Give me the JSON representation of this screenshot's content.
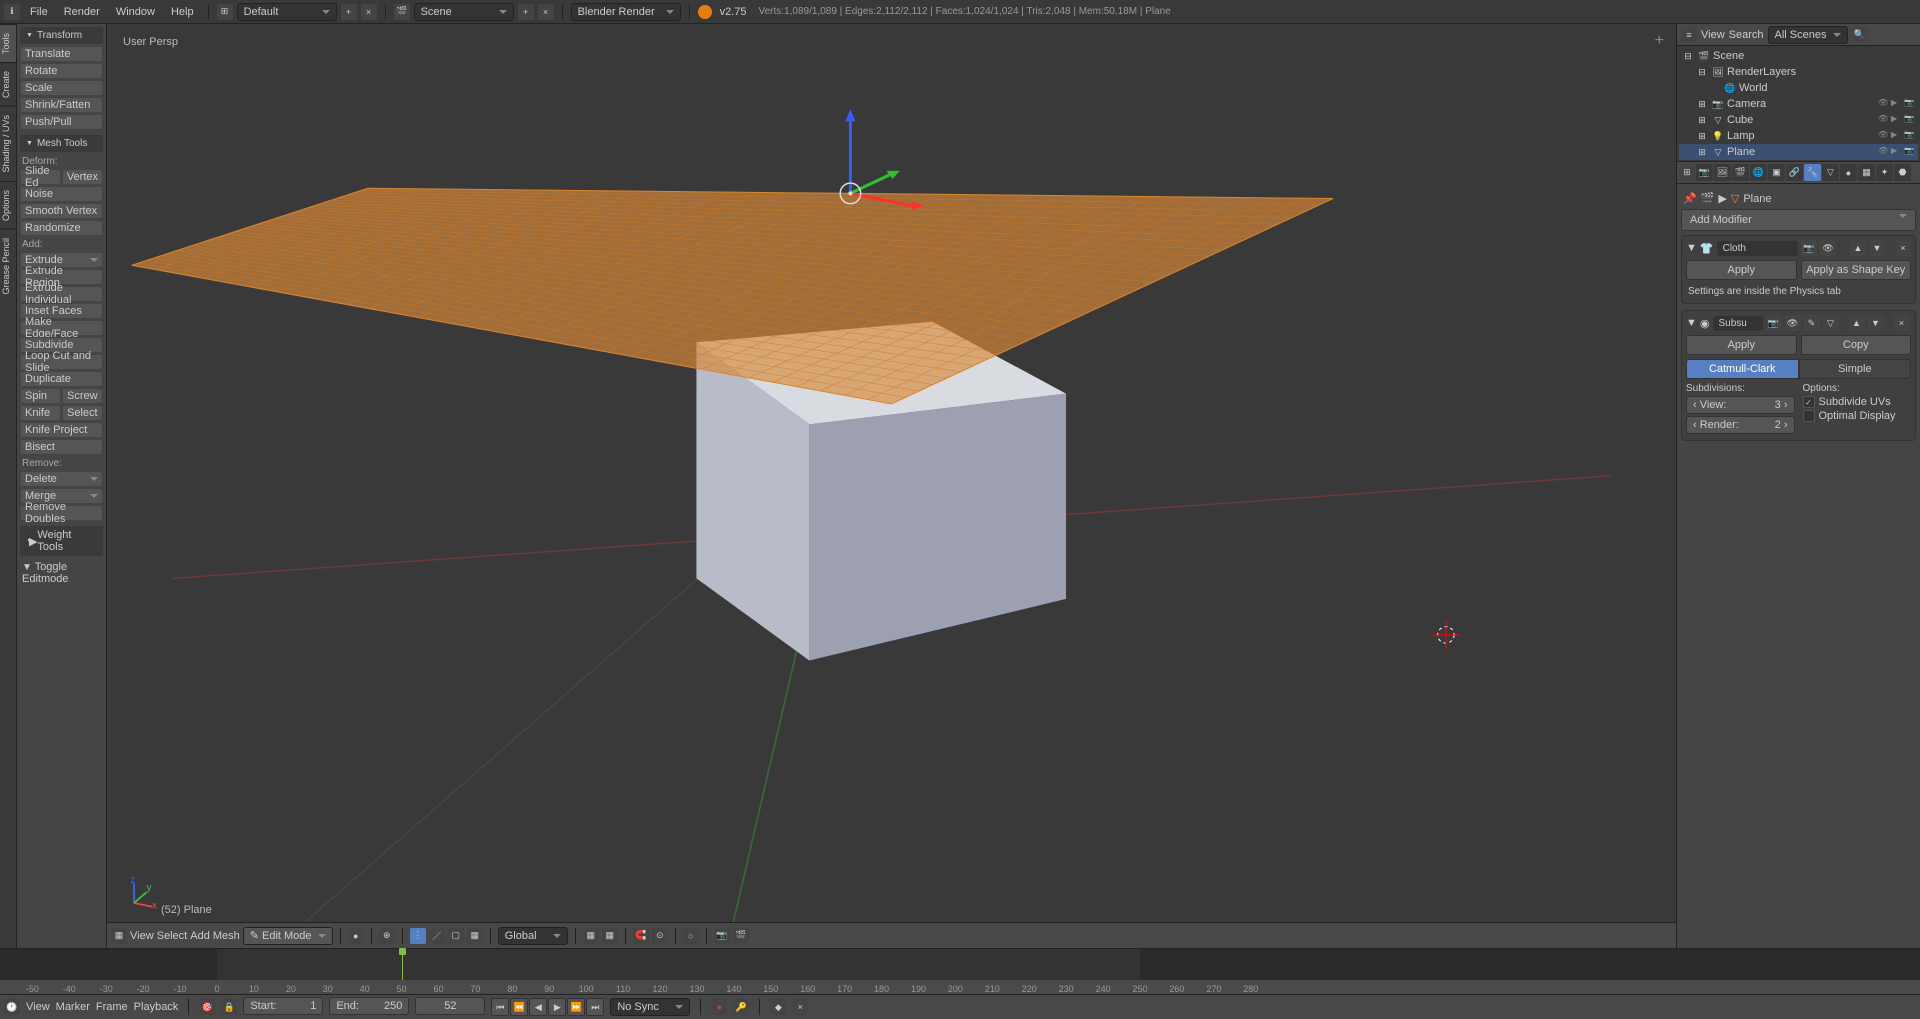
{
  "header": {
    "menus": [
      "File",
      "Render",
      "Window",
      "Help"
    ],
    "layout": "Default",
    "scene": "Scene",
    "engine": "Blender Render",
    "version": "v2.75",
    "stats": "Verts:1,089/1,089 | Edges:2,112/2,112 | Faces:1,024/1,024 | Tris:2,048 | Mem:50.18M | Plane"
  },
  "toolshelf": {
    "tabs": [
      "Tools",
      "Create",
      "Shading / UVs",
      "Options",
      "Grease Pencil"
    ],
    "transform": {
      "title": "Transform",
      "items": [
        "Translate",
        "Rotate",
        "Scale",
        "Shrink/Fatten",
        "Push/Pull"
      ]
    },
    "meshtools": {
      "title": "Mesh Tools",
      "deform_label": "Deform:",
      "deform": [
        "Slide Ed",
        "Vertex",
        "Noise",
        "Smooth Vertex",
        "Randomize"
      ],
      "add_label": "Add:",
      "add": [
        "Extrude",
        "Extrude Region",
        "Extrude Individual",
        "Inset Faces",
        "Make Edge/Face",
        "Subdivide",
        "Loop Cut and Slide",
        "Duplicate",
        "Spin",
        "Screw",
        "Knife",
        "Select",
        "Knife Project",
        "Bisect"
      ],
      "remove_label": "Remove:",
      "remove": [
        "Delete",
        "Merge",
        "Remove Doubles"
      ]
    },
    "weighttools": "Weight Tools",
    "history": "Toggle Editmode"
  },
  "viewport": {
    "persp": "User Persp",
    "object": "(52) Plane",
    "menus": [
      "View",
      "Select",
      "Add",
      "Mesh"
    ],
    "mode": "Edit Mode",
    "orientation": "Global"
  },
  "outliner": {
    "menu": "View",
    "search": "Search",
    "filter": "All Scenes",
    "tree": [
      {
        "name": "Scene",
        "icon": "🎬",
        "depth": 0,
        "exp": true
      },
      {
        "name": "RenderLayers",
        "icon": "🖼",
        "depth": 1,
        "exp": true,
        "extra": true
      },
      {
        "name": "World",
        "icon": "🌐",
        "depth": 2
      },
      {
        "name": "Camera",
        "icon": "📷",
        "depth": 1,
        "toggles": true,
        "exp": false
      },
      {
        "name": "Cube",
        "icon": "▽",
        "depth": 1,
        "toggles": true,
        "exp": false
      },
      {
        "name": "Lamp",
        "icon": "💡",
        "depth": 1,
        "toggles": true,
        "exp": false
      },
      {
        "name": "Plane",
        "icon": "▽",
        "depth": 1,
        "toggles": true,
        "exp": false,
        "sel": true
      }
    ]
  },
  "properties": {
    "breadcrumb": "Plane",
    "add_modifier": "Add Modifier",
    "mod1": {
      "name": "Cloth",
      "apply": "Apply",
      "apply_shape": "Apply as Shape Key",
      "note": "Settings are inside the Physics tab"
    },
    "mod2": {
      "name": "Subsu",
      "apply": "Apply",
      "copy": "Copy",
      "type1": "Catmull-Clark",
      "type2": "Simple",
      "subdivisions": "Subdivisions:",
      "options": "Options:",
      "view_label": "View:",
      "view_val": "3",
      "render_label": "Render:",
      "render_val": "2",
      "subdivide_uv": "Subdivide UVs",
      "optimal": "Optimal Display"
    }
  },
  "timeline": {
    "menus": [
      "View",
      "Marker",
      "Frame",
      "Playback"
    ],
    "start_label": "Start:",
    "start": "1",
    "end_label": "End:",
    "end": "250",
    "current": "52",
    "sync": "No Sync",
    "ticks": [
      -50,
      -40,
      -30,
      -20,
      -10,
      0,
      10,
      20,
      30,
      40,
      50,
      60,
      70,
      80,
      90,
      100,
      110,
      120,
      130,
      140,
      150,
      160,
      170,
      180,
      190,
      200,
      210,
      220,
      230,
      240,
      250,
      260,
      270,
      280
    ]
  }
}
